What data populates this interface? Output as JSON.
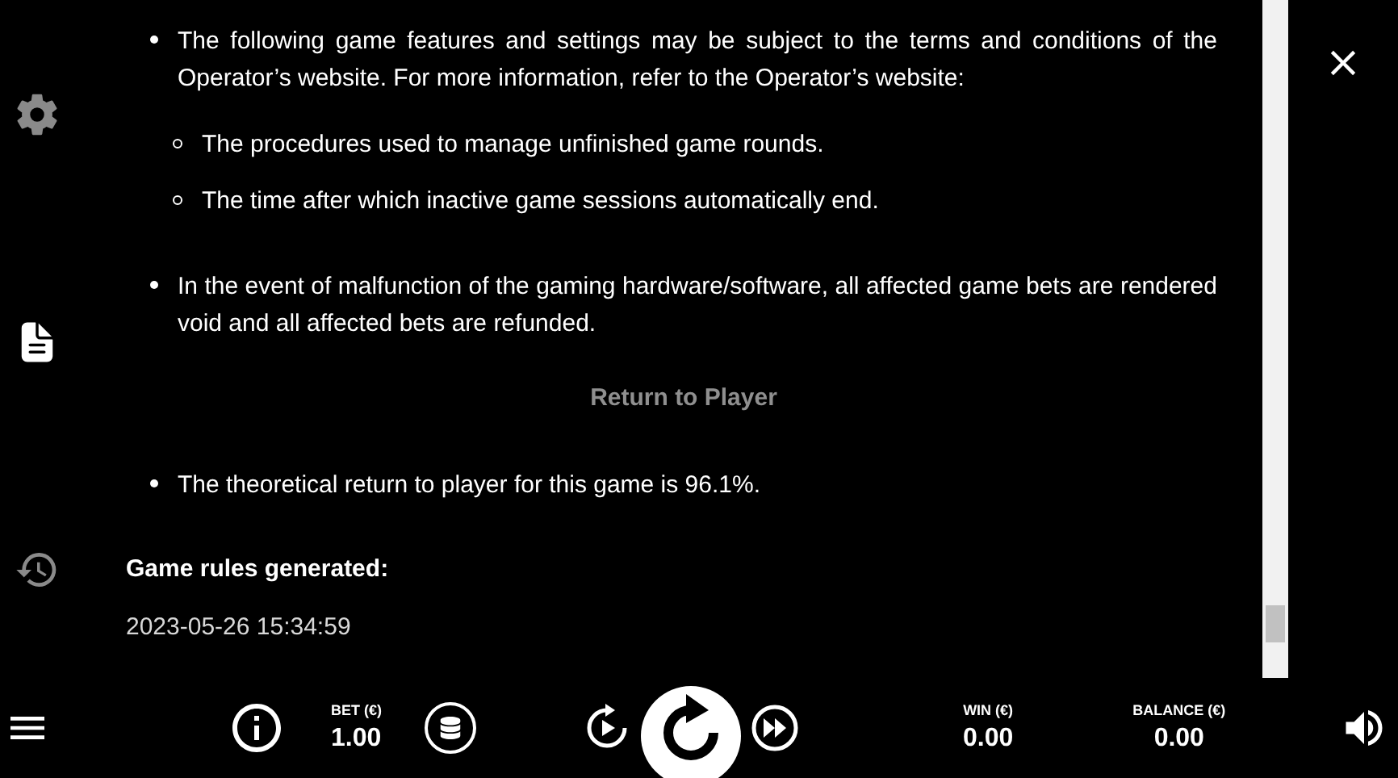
{
  "sidebar": {
    "items": [
      {
        "kind": "settings",
        "selected": false
      },
      {
        "kind": "rules",
        "selected": true
      },
      {
        "kind": "history",
        "selected": false
      }
    ]
  },
  "content": {
    "blocks": [
      {
        "kind": "bullet",
        "text": "The following game features and settings may be subject to the terms and conditions of the Operator’s website. For more information, refer to the Operator’s website:",
        "children": [
          "The procedures used to manage unfinished game rounds.",
          "The time after which inactive game sessions automatically end."
        ]
      },
      {
        "kind": "bullet",
        "text": "In the event of malfunction of the gaming hardware/software, all affected game bets are rendered void and all affected bets are refunded."
      },
      {
        "kind": "heading",
        "text": "Return to Player"
      },
      {
        "kind": "bullet",
        "text": "The theoretical return to player for this game is 96.1%."
      },
      {
        "kind": "label",
        "text": "Game rules generated:"
      },
      {
        "kind": "date",
        "text": "2023-05-26 15:34:59"
      }
    ]
  },
  "bottom_bar": {
    "bet": {
      "label": "BET (€)",
      "value": "1.00"
    },
    "win": {
      "label": "WIN (€)",
      "value": "0.00"
    },
    "balance": {
      "label": "BALANCE (€)",
      "value": "0.00"
    }
  }
}
